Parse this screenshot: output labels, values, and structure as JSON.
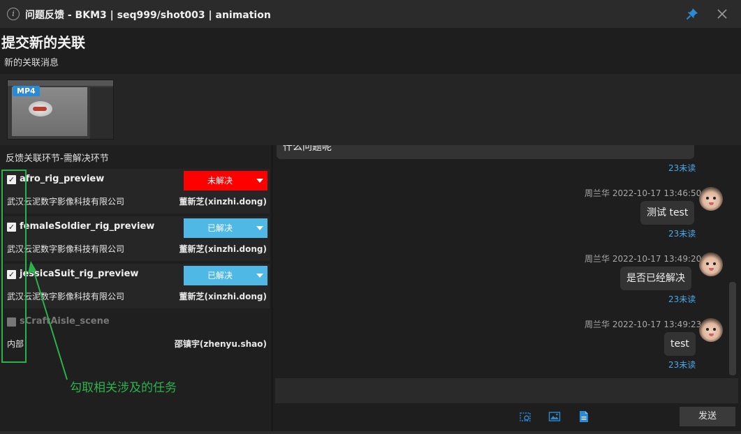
{
  "window": {
    "title": "问题反馈 - BKM3 | seq999/shot003 | animation"
  },
  "form": {
    "heading": "提交新的关联",
    "subheading": "新的关联消息",
    "attachment_badge": "MP4"
  },
  "tasks_section": {
    "title": "反馈关联环节-需解决环节",
    "items": [
      {
        "checked": true,
        "name": "afro_rig_preview",
        "status": "未解决",
        "company": "武汉云泥数字影像科技有限公司",
        "person": "董新芝(xinzhi.dong)"
      },
      {
        "checked": true,
        "name": "femaleSoldier_rig_preview",
        "status": "已解决",
        "company": "武汉云泥数字影像科技有限公司",
        "person": "董新芝(xinzhi.dong)"
      },
      {
        "checked": true,
        "name": "jessicaSuit_rig_preview",
        "status": "已解决",
        "company": "武汉云泥数字影像科技有限公司",
        "person": "董新芝(xinzhi.dong)"
      },
      {
        "checked": false,
        "name": "sCraftAisle_scene",
        "status": "",
        "company": "内部",
        "person": "邵镇宇(zhenyu.shao)"
      }
    ]
  },
  "annotation": {
    "text": "勾取相关涉及的任务",
    "color": "#2bb34b"
  },
  "chat": {
    "messages": [
      {
        "meta": "",
        "text": "什么问题呢",
        "unread": "23未读"
      },
      {
        "meta": "周兰华 2022-10-17 13:46:50",
        "text": "测试 test",
        "unread": "23未读"
      },
      {
        "meta": "周兰华 2022-10-17 13:49:20",
        "text": "是否已经解决",
        "unread": "23未读"
      },
      {
        "meta": "周兰华 2022-10-17 13:49:23",
        "text": "test",
        "unread": "23未读"
      }
    ]
  },
  "composer": {
    "send_label": "发送",
    "icons": [
      "screenshot-icon",
      "image-icon",
      "file-icon"
    ]
  },
  "colors": {
    "unresolved": "#ff0000",
    "resolved": "#4fb8e5",
    "unread_link": "#4aa8e8"
  }
}
